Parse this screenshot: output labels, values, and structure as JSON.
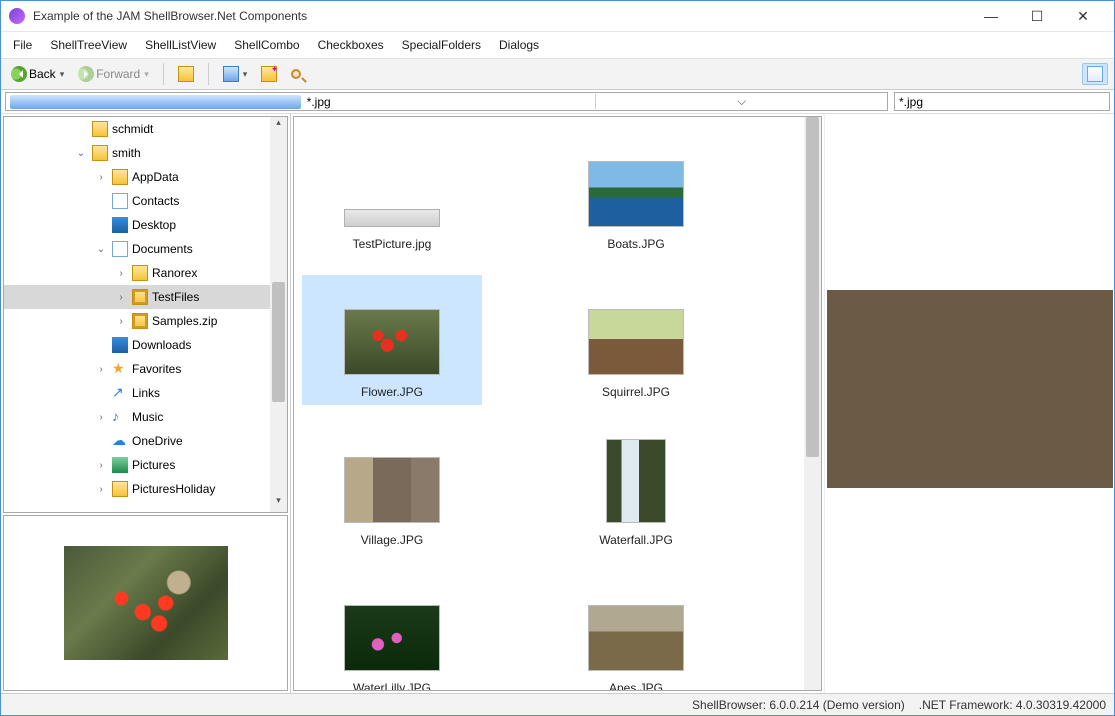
{
  "window": {
    "title": "Example of the JAM ShellBrowser.Net Components"
  },
  "menu": [
    "File",
    "ShellTreeView",
    "ShellListView",
    "ShellCombo",
    "Checkboxes",
    "SpecialFolders",
    "Dialogs"
  ],
  "toolbar": {
    "back": "Back",
    "forward": "Forward"
  },
  "path_text": "*.jpg",
  "filter_text": "*.jpg",
  "tree": [
    {
      "depth": 0,
      "tw": "",
      "icon": "folder",
      "label": "schmidt"
    },
    {
      "depth": 0,
      "tw": "v",
      "icon": "folder",
      "label": "smith"
    },
    {
      "depth": 1,
      "tw": ">",
      "icon": "folder",
      "label": "AppData"
    },
    {
      "depth": 1,
      "tw": "",
      "icon": "doc",
      "label": "Contacts"
    },
    {
      "depth": 1,
      "tw": "",
      "icon": "blue",
      "label": "Desktop"
    },
    {
      "depth": 1,
      "tw": "v",
      "icon": "doc",
      "label": "Documents"
    },
    {
      "depth": 2,
      "tw": ">",
      "icon": "folder",
      "label": "Ranorex"
    },
    {
      "depth": 2,
      "tw": ">",
      "icon": "zip",
      "label": "TestFiles",
      "selected": true
    },
    {
      "depth": 2,
      "tw": ">",
      "icon": "zip",
      "label": "Samples.zip"
    },
    {
      "depth": 1,
      "tw": "",
      "icon": "blue",
      "label": "Downloads"
    },
    {
      "depth": 1,
      "tw": ">",
      "icon": "star",
      "label": "Favorites"
    },
    {
      "depth": 1,
      "tw": "",
      "icon": "link",
      "label": "Links"
    },
    {
      "depth": 1,
      "tw": ">",
      "icon": "note",
      "label": "Music"
    },
    {
      "depth": 1,
      "tw": "",
      "icon": "cloud",
      "label": "OneDrive"
    },
    {
      "depth": 1,
      "tw": ">",
      "icon": "green",
      "label": "Pictures"
    },
    {
      "depth": 1,
      "tw": ">",
      "icon": "folder",
      "label": "PicturesHoliday"
    }
  ],
  "files": [
    {
      "name": "TestPicture.jpg",
      "cls": "sc-test",
      "selected": false,
      "thumbH": 18
    },
    {
      "name": "Boats.JPG",
      "cls": "sc-boats",
      "selected": false
    },
    {
      "name": "Flower.JPG",
      "cls": "sc-flower",
      "selected": true
    },
    {
      "name": "Squirrel.JPG",
      "cls": "sc-squirrel",
      "selected": false
    },
    {
      "name": "Village.JPG",
      "cls": "sc-village",
      "selected": false
    },
    {
      "name": "Waterfall.JPG",
      "cls": "sc-waterfall",
      "selected": false,
      "thumbW": 60,
      "thumbH": 84
    },
    {
      "name": "WaterLilly.JPG",
      "cls": "sc-lilly",
      "selected": false
    },
    {
      "name": "Apes.JPG",
      "cls": "sc-apes",
      "selected": false
    }
  ],
  "status": {
    "browser": "ShellBrowser: 6.0.0.214 (Demo version)",
    "framework": ".NET Framework: 4.0.30319.42000"
  }
}
